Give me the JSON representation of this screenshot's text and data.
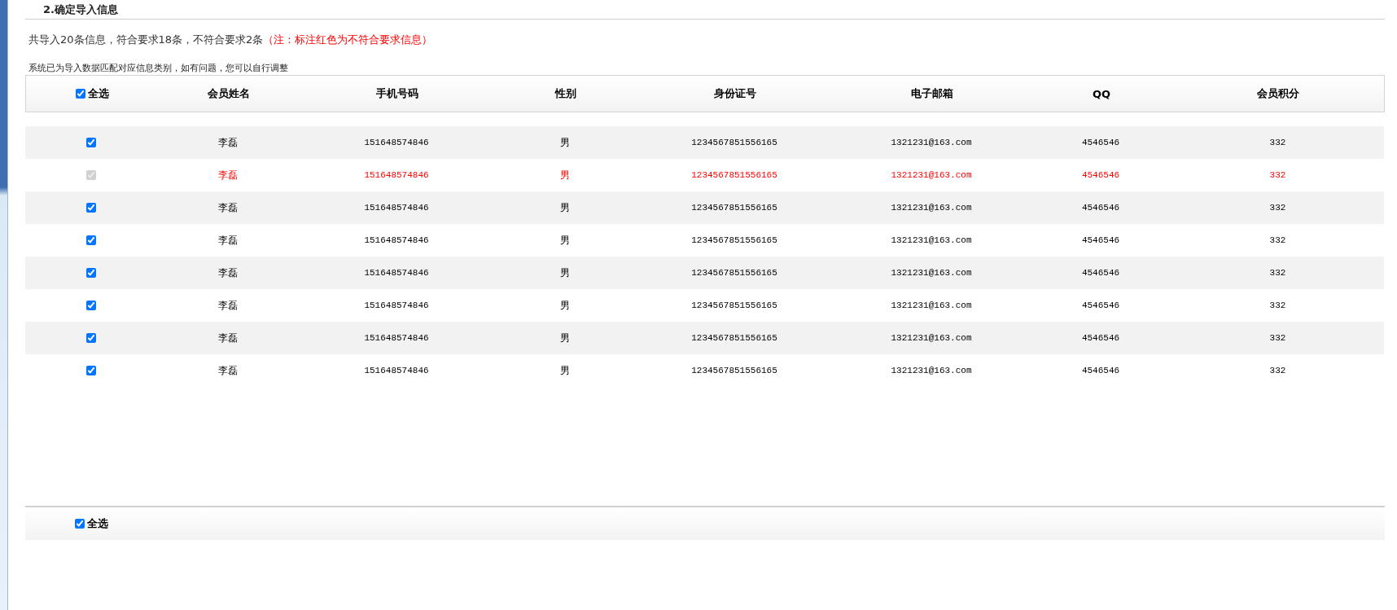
{
  "section_title": "2.确定导入信息",
  "summary": {
    "text": "共导入20条信息，符合要求18条，不符合要求2条",
    "note": "（注：标注红色为不符合要求信息）"
  },
  "hint": "系统已为导入数据匹配对应信息类别，如有问题，您可以自行调整",
  "table": {
    "select_all": {
      "label": "全选",
      "checked": true
    },
    "columns": [
      "会员姓名",
      "手机号码",
      "性别",
      "身份证号",
      "电子邮箱",
      "QQ",
      "会员积分"
    ],
    "rows": [
      {
        "checked": true,
        "invalid": false,
        "cells": [
          "李磊",
          "151648574846",
          "男",
          "1234567851556165",
          "1321231@163.com",
          "4546546",
          "332"
        ]
      },
      {
        "checked": true,
        "invalid": true,
        "cells": [
          "李磊",
          "151648574846",
          "男",
          "1234567851556165",
          "1321231@163.com",
          "4546546",
          "332"
        ]
      },
      {
        "checked": true,
        "invalid": false,
        "cells": [
          "李磊",
          "151648574846",
          "男",
          "1234567851556165",
          "1321231@163.com",
          "4546546",
          "332"
        ]
      },
      {
        "checked": true,
        "invalid": false,
        "cells": [
          "李磊",
          "151648574846",
          "男",
          "1234567851556165",
          "1321231@163.com",
          "4546546",
          "332"
        ]
      },
      {
        "checked": true,
        "invalid": false,
        "cells": [
          "李磊",
          "151648574846",
          "男",
          "1234567851556165",
          "1321231@163.com",
          "4546546",
          "332"
        ]
      },
      {
        "checked": true,
        "invalid": false,
        "cells": [
          "李磊",
          "151648574846",
          "男",
          "1234567851556165",
          "1321231@163.com",
          "4546546",
          "332"
        ]
      },
      {
        "checked": true,
        "invalid": false,
        "cells": [
          "李磊",
          "151648574846",
          "男",
          "1234567851556165",
          "1321231@163.com",
          "4546546",
          "332"
        ]
      },
      {
        "checked": true,
        "invalid": false,
        "cells": [
          "李磊",
          "151648574846",
          "男",
          "1234567851556165",
          "1321231@163.com",
          "4546546",
          "332"
        ]
      }
    ]
  },
  "footer": {
    "select_all": {
      "label": "全选",
      "checked": true
    }
  }
}
